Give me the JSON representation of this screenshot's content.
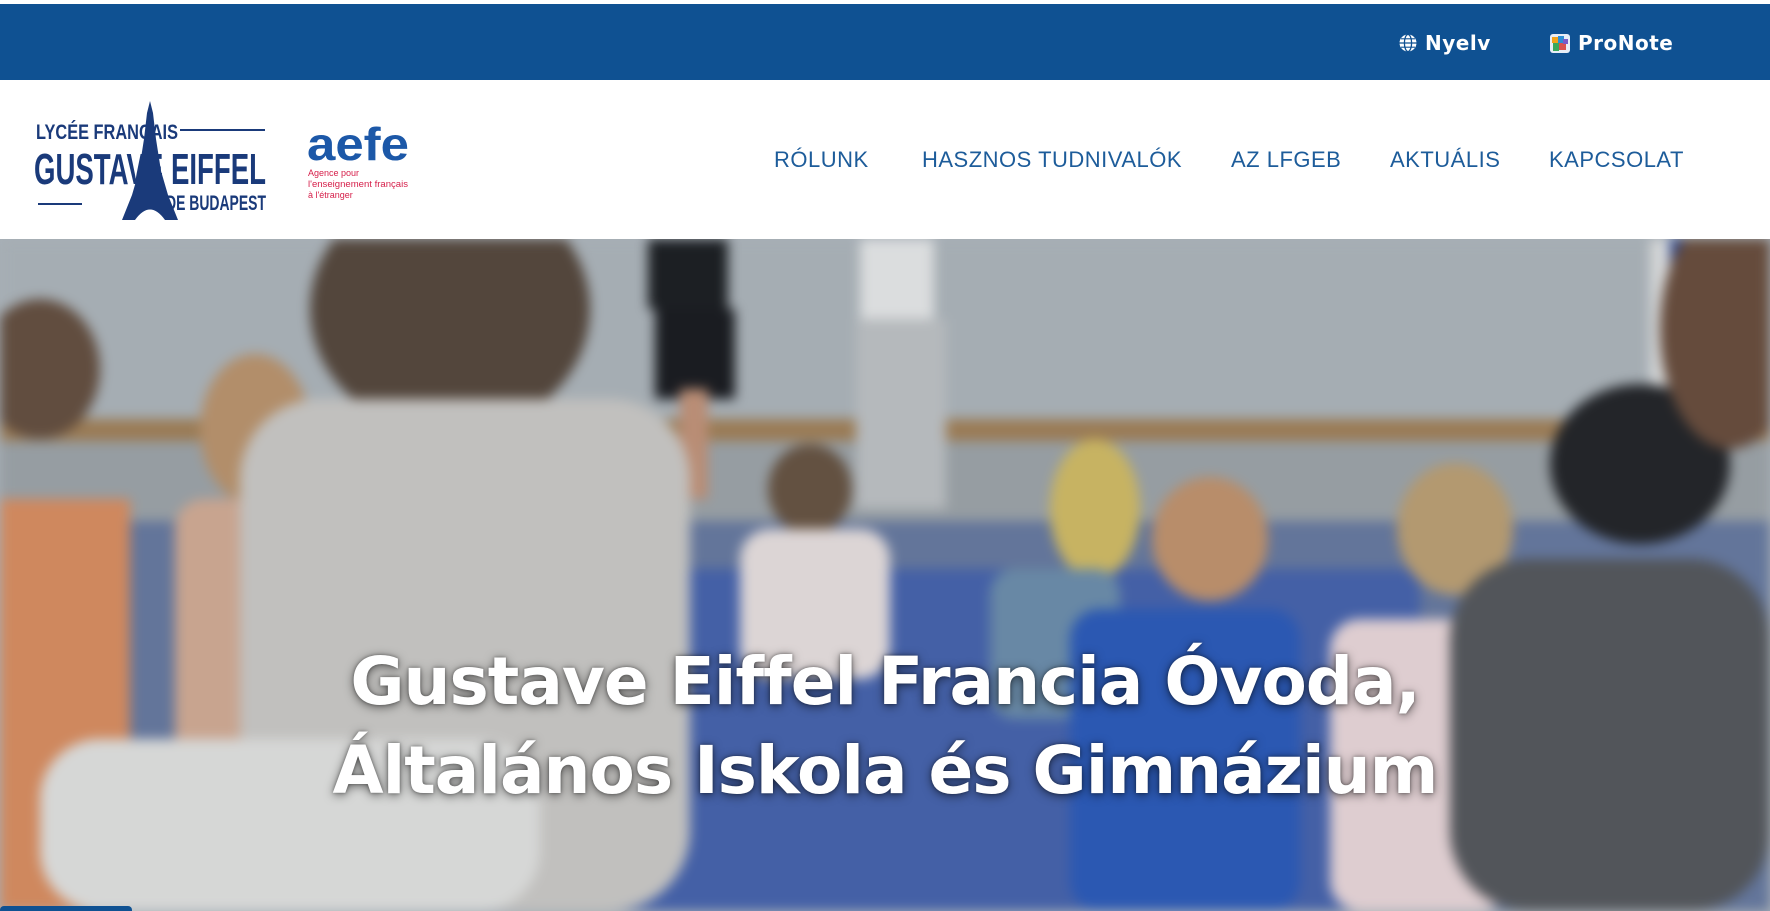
{
  "topbar": {
    "language": {
      "label": "Nyelv",
      "icon": "globe-icon"
    },
    "pronote": {
      "label": "ProNote",
      "icon": "pronote-icon"
    }
  },
  "logos": {
    "lycee": {
      "line1": "LYCÉE FRANÇAIS",
      "line2": "GUSTAVE EIFFEL",
      "line3": "DE BUDAPEST"
    },
    "aefe": {
      "word": "aefe",
      "line1": "Agence pour",
      "line2": "l'enseignement français",
      "line3": "à l'étranger"
    }
  },
  "nav": {
    "items": [
      {
        "label": "RÓLUNK"
      },
      {
        "label": "HASZNOS TUDNIVALÓK"
      },
      {
        "label": "AZ LFGEB"
      },
      {
        "label": "AKTUÁLIS"
      },
      {
        "label": "KAPCSOLAT"
      }
    ]
  },
  "hero": {
    "title_line1": "Gustave Eiffel Francia Óvoda,",
    "title_line2": "Általános Iskola és Gimnázium"
  },
  "colors": {
    "topbar": "#0f5192",
    "nav_text": "#1d5c9a",
    "logo_navy": "#1a3a7a",
    "aefe_blue": "#1c58a8",
    "aefe_red": "#d6204b"
  }
}
